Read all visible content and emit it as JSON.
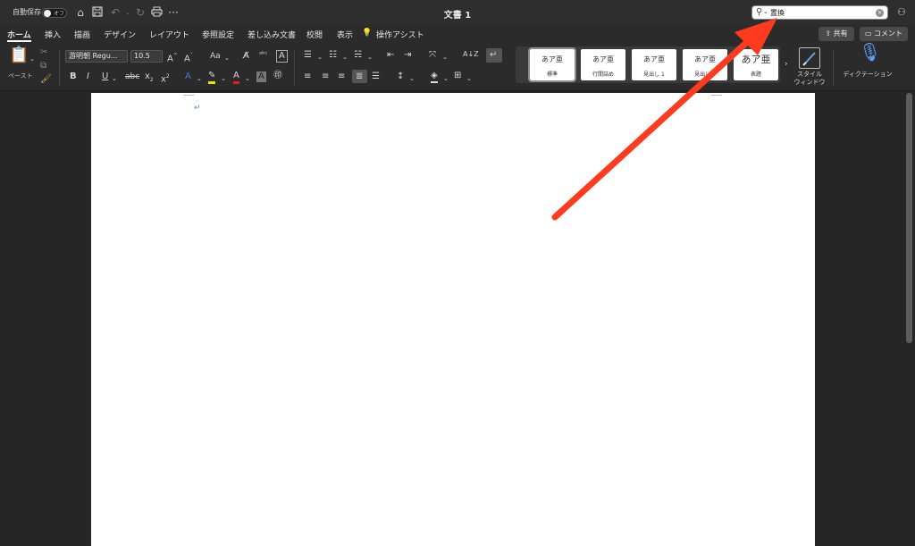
{
  "titlebar": {
    "autosave_label": "自動保存",
    "toggle_state": "オフ",
    "document_title": "文書 1",
    "search_value": "置換",
    "icons": [
      "home-icon",
      "save-icon",
      "undo-icon",
      "redo-icon",
      "print-icon",
      "more-icon",
      "search-icon",
      "person-share-icon"
    ]
  },
  "tabs": [
    {
      "label": "ホーム",
      "active": true
    },
    {
      "label": "挿入"
    },
    {
      "label": "描画"
    },
    {
      "label": "デザイン"
    },
    {
      "label": "レイアウト"
    },
    {
      "label": "参照設定"
    },
    {
      "label": "差し込み文書"
    },
    {
      "label": "校閲"
    },
    {
      "label": "表示"
    },
    {
      "label": "操作アシスト"
    }
  ],
  "actions": {
    "share_label": "共有",
    "comment_label": "コメント"
  },
  "ribbon": {
    "paste_label": "ペースト",
    "font_name": "游明朝 Regu...",
    "font_size": "10.5",
    "case_label": "Aa",
    "styles": [
      {
        "sample": "あア亜",
        "name": "標準",
        "selected": true
      },
      {
        "sample": "あア亜",
        "name": "行間詰め"
      },
      {
        "sample": "あア亜",
        "name": "見出し 1"
      },
      {
        "sample": "あア亜",
        "name": "見出し 2"
      },
      {
        "sample": "あア亜",
        "name": "表題"
      }
    ],
    "style_window_label": "スタイル\nウィンドウ",
    "dictation_label": "ディクテーション"
  },
  "colors": {
    "accent_arrow": "#ff3b1f",
    "paragraph_mark": "#5a8bd6"
  }
}
